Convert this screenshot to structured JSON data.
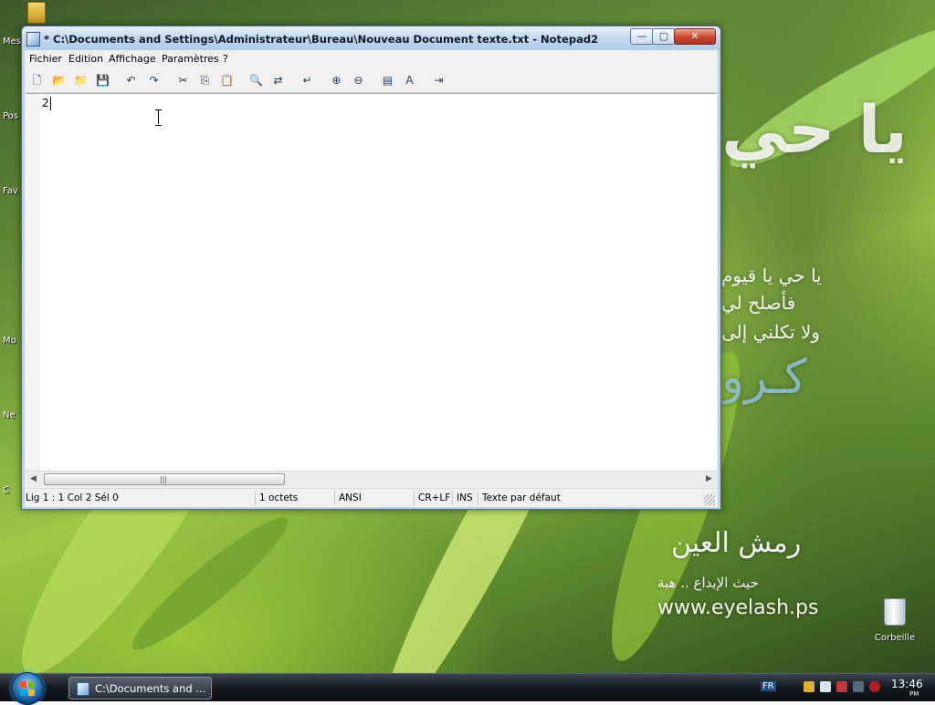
{
  "desktop": {
    "left_labels": [
      "Mes",
      "Pos",
      "Fav",
      "Mo",
      "Ne",
      "C"
    ],
    "recycle_bin_label": "Corbeille",
    "wallpaper_url_text": "www.eyelash.ps",
    "wallpaper_latin_text": "كـرو"
  },
  "window": {
    "title": "* C:\\Documents and Settings\\Administrateur\\Bureau\\Nouveau Document texte.txt - Notepad2",
    "buttons": {
      "minimize": "—",
      "maximize": "▢",
      "close": "✕"
    },
    "menu": [
      "Fichier",
      "Edition",
      "Affichage",
      "Paramètres",
      "?"
    ],
    "toolbar_icons": [
      "new-icon",
      "open-icon",
      "browse-icon",
      "save-icon",
      "undo-icon",
      "redo-icon",
      "cut-icon",
      "copy-icon",
      "paste-icon",
      "find-icon",
      "replace-icon",
      "wordwrap-icon",
      "zoom-in-icon",
      "zoom-out-icon",
      "scheme-icon",
      "font-icon",
      "exit-icon"
    ],
    "editor_text": "2",
    "statusbar": {
      "position": "Lig 1 : 1   Col 2   Sél 0",
      "size": "1 octets",
      "encoding": "ANSI",
      "line_endings": "CR+LF",
      "insert_mode": "INS",
      "scheme": "Texte par défaut"
    }
  },
  "taskbar": {
    "task_label": "C:\\Documents and ...",
    "language": "FR",
    "clock_time": "13:46",
    "clock_suffix": "PM"
  }
}
